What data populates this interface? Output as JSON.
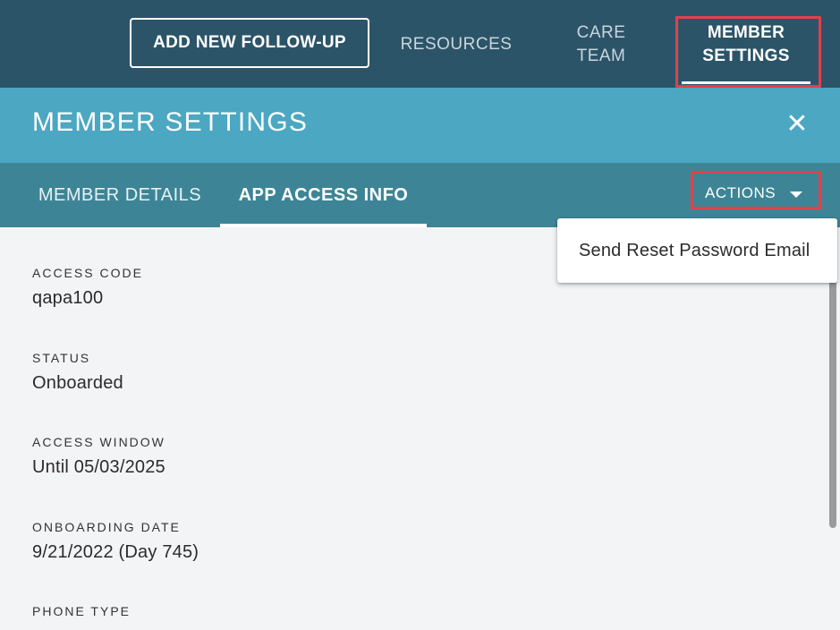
{
  "topnav": {
    "add_followup_label": "ADD NEW FOLLOW-UP",
    "resources_label": "RESOURCES",
    "care_team_line1": "CARE",
    "care_team_line2": "TEAM",
    "member_settings_line1": "MEMBER",
    "member_settings_line2": "SETTINGS"
  },
  "panel": {
    "title": "MEMBER SETTINGS",
    "close_glyph": "✕"
  },
  "tabs": [
    {
      "label": "MEMBER DETAILS",
      "active": false
    },
    {
      "label": "APP ACCESS INFO",
      "active": true
    }
  ],
  "actions": {
    "label": "ACTIONS",
    "menu_items": [
      "Send Reset Password Email"
    ]
  },
  "fields": [
    {
      "label": "ACCESS CODE",
      "value": "qapa100"
    },
    {
      "label": "STATUS",
      "value": "Onboarded"
    },
    {
      "label": "ACCESS WINDOW",
      "value": "Until 05/03/2025"
    },
    {
      "label": "ONBOARDING DATE",
      "value": "9/21/2022 (Day 745)"
    },
    {
      "label": "PHONE TYPE",
      "value": ""
    }
  ],
  "colors": {
    "topbar": "#2c5469",
    "panel_header": "#4ba7c2",
    "tabs_bar": "#3d8596",
    "highlight": "#e0424b"
  }
}
